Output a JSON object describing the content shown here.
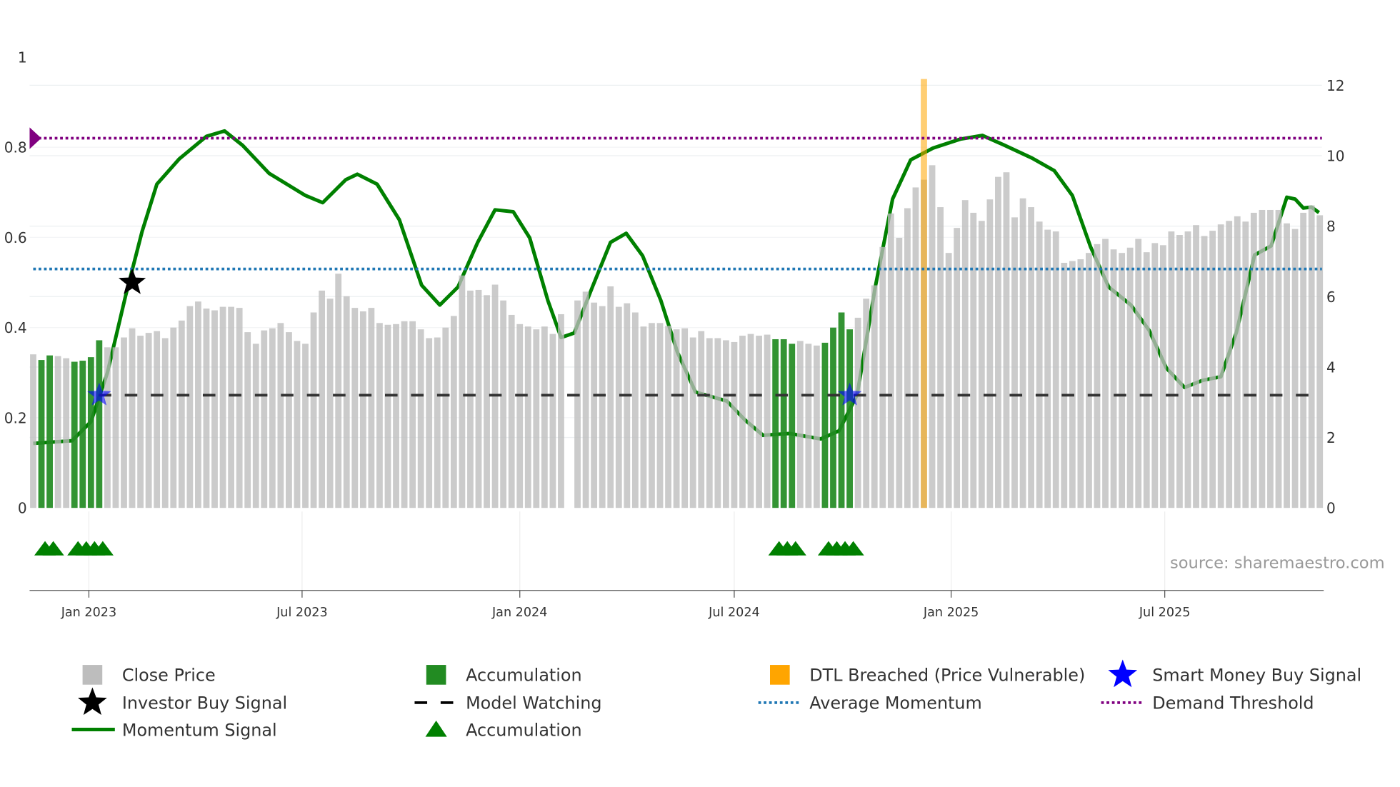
{
  "chart_data": {
    "type": "bar",
    "title": "",
    "source": "source: sharemaestro.com",
    "left_axis": {
      "range": [
        0,
        1
      ],
      "ticks": [
        "0",
        "0.2",
        "0.4",
        "0.6",
        "0.8",
        "1"
      ],
      "tick_values": [
        0,
        0.2,
        0.4,
        0.6,
        0.8,
        1
      ]
    },
    "right_axis": {
      "range": [
        0,
        12
      ],
      "ticks": [
        "0",
        "2",
        "4",
        "6",
        "8",
        "10",
        "12"
      ],
      "tick_values": [
        0,
        2,
        4,
        6,
        8,
        10,
        12
      ]
    },
    "x_ticks": [
      {
        "label": "Jan 2023",
        "week": 6.75
      },
      {
        "label": "Jul 2023",
        "week": 32.6
      },
      {
        "label": "Jan 2024",
        "week": 59.0
      },
      {
        "label": "Jul 2024",
        "week": 85.0
      },
      {
        "label": "Jan 2025",
        "week": 111.3
      },
      {
        "label": "Jul 2025",
        "week": 137.2
      }
    ],
    "close_price": [
      4.36,
      4.2,
      4.33,
      4.31,
      4.25,
      4.15,
      4.18,
      4.28,
      4.76,
      4.56,
      4.56,
      4.84,
      5.1,
      4.89,
      4.97,
      5.02,
      4.82,
      5.12,
      5.32,
      5.73,
      5.86,
      5.66,
      5.61,
      5.71,
      5.71,
      5.68,
      4.99,
      4.66,
      5.04,
      5.1,
      5.25,
      4.99,
      4.74,
      4.66,
      5.55,
      6.17,
      5.94,
      6.65,
      6.01,
      5.68,
      5.58,
      5.68,
      5.25,
      5.2,
      5.22,
      5.3,
      5.3,
      5.07,
      4.82,
      4.84,
      5.12,
      5.45,
      6.6,
      6.17,
      6.19,
      6.04,
      6.34,
      5.89,
      5.48,
      5.22,
      5.15,
      5.07,
      5.15,
      4.94,
      5.5,
      null,
      5.89,
      6.14,
      5.83,
      5.73,
      6.29,
      5.71,
      5.81,
      5.55,
      5.15,
      5.25,
      5.25,
      5.17,
      5.07,
      5.1,
      4.84,
      5.02,
      4.82,
      4.82,
      4.76,
      4.71,
      4.89,
      4.94,
      4.89,
      4.92,
      4.79,
      4.79,
      4.66,
      4.74,
      4.66,
      4.61,
      4.69,
      5.12,
      5.55,
      5.07,
      5.4,
      5.94,
      6.32,
      7.41,
      8.36,
      7.67,
      8.51,
      9.1,
      9.32,
      9.73,
      8.54,
      7.24,
      7.95,
      8.74,
      8.38,
      8.15,
      8.76,
      9.4,
      9.53,
      8.25,
      8.79,
      8.54,
      8.13,
      7.9,
      7.85,
      6.96,
      7.01,
      7.06,
      7.24,
      7.49,
      7.64,
      7.34,
      7.24,
      7.39,
      7.64,
      7.26,
      7.52,
      7.46,
      7.85,
      7.75,
      7.85,
      8.03,
      7.72,
      7.87,
      8.05,
      8.15,
      8.28,
      8.13,
      8.38,
      8.46,
      8.46,
      8.46,
      8.08,
      7.92,
      8.38,
      8.59,
      8.31
    ],
    "accumulation_weeks": [
      1,
      2,
      5,
      6,
      7,
      8,
      90,
      91,
      92,
      96,
      97,
      98,
      99
    ],
    "dtl_breached_weeks": [
      108
    ],
    "momentum": [
      [
        0,
        0.143
      ],
      [
        4.7,
        0.149
      ],
      [
        7.0,
        0.191
      ],
      [
        9.0,
        0.3
      ],
      [
        11.2,
        0.47
      ],
      [
        13.2,
        0.613
      ],
      [
        15.0,
        0.718
      ],
      [
        17.7,
        0.774
      ],
      [
        21.0,
        0.824
      ],
      [
        23.2,
        0.836
      ],
      [
        25.4,
        0.804
      ],
      [
        28.6,
        0.742
      ],
      [
        33.0,
        0.693
      ],
      [
        35.1,
        0.677
      ],
      [
        37.9,
        0.728
      ],
      [
        39.3,
        0.74
      ],
      [
        41.7,
        0.718
      ],
      [
        44.4,
        0.639
      ],
      [
        47.1,
        0.494
      ],
      [
        49.3,
        0.45
      ],
      [
        51.5,
        0.49
      ],
      [
        53.9,
        0.589
      ],
      [
        56.0,
        0.661
      ],
      [
        58.2,
        0.657
      ],
      [
        60.2,
        0.599
      ],
      [
        62.4,
        0.46
      ],
      [
        64.0,
        0.378
      ],
      [
        65.6,
        0.388
      ],
      [
        67.8,
        0.49
      ],
      [
        70.0,
        0.589
      ],
      [
        71.9,
        0.609
      ],
      [
        73.9,
        0.559
      ],
      [
        76.1,
        0.46
      ],
      [
        78.1,
        0.346
      ],
      [
        80.3,
        0.257
      ],
      [
        84.1,
        0.237
      ],
      [
        86.3,
        0.195
      ],
      [
        88.5,
        0.161
      ],
      [
        91.7,
        0.165
      ],
      [
        95.5,
        0.153
      ],
      [
        97.7,
        0.171
      ],
      [
        99.9,
        0.251
      ],
      [
        102.1,
        0.49
      ],
      [
        104.2,
        0.685
      ],
      [
        106.4,
        0.772
      ],
      [
        109.1,
        0.798
      ],
      [
        112.4,
        0.818
      ],
      [
        115.1,
        0.826
      ],
      [
        117.8,
        0.804
      ],
      [
        121.1,
        0.776
      ],
      [
        123.8,
        0.748
      ],
      [
        126.0,
        0.693
      ],
      [
        128.2,
        0.579
      ],
      [
        130.4,
        0.49
      ],
      [
        133.1,
        0.45
      ],
      [
        135.3,
        0.394
      ],
      [
        137.4,
        0.31
      ],
      [
        139.6,
        0.267
      ],
      [
        141.8,
        0.283
      ],
      [
        144.0,
        0.291
      ],
      [
        145.9,
        0.39
      ],
      [
        148.1,
        0.561
      ],
      [
        150.1,
        0.581
      ],
      [
        152.0,
        0.689
      ],
      [
        153.0,
        0.685
      ],
      [
        154.0,
        0.665
      ],
      [
        155.0,
        0.667
      ],
      [
        155.9,
        0.655
      ]
    ],
    "average_momentum": 0.53,
    "demand_threshold": 0.82,
    "model_watching": 0.25,
    "investor_buy_signals": [
      [
        12.0,
        0.5
      ]
    ],
    "smart_money_buy_signals": [
      [
        8.0,
        0.25
      ],
      [
        99.0,
        0.25
      ]
    ],
    "colors": {
      "close": "#bdbdbd",
      "accumulation": "#228b22",
      "dtl": "#ffa500",
      "momentum": "#008000",
      "average": "#1f77b4",
      "threshold": "#800080",
      "watching": "#333333",
      "smart": "#0000ff",
      "investor": "#000000"
    },
    "legend": [
      {
        "label": "Close Price",
        "symbol": "gray-square"
      },
      {
        "label": "Accumulation",
        "symbol": "green-square"
      },
      {
        "label": "DTL Breached (Price Vulnerable)",
        "symbol": "orange-square"
      },
      {
        "label": "Smart Money Buy Signal",
        "symbol": "blue-star"
      },
      {
        "label": "Investor Buy Signal",
        "symbol": "black-star"
      },
      {
        "label": "Model Watching",
        "symbol": "dash"
      },
      {
        "label": "Average Momentum",
        "symbol": "blue-dots"
      },
      {
        "label": "Demand Threshold",
        "symbol": "purple-dots"
      },
      {
        "label": "Momentum Signal",
        "symbol": "green-line"
      },
      {
        "label": "Accumulation",
        "symbol": "green-triangle"
      }
    ]
  }
}
